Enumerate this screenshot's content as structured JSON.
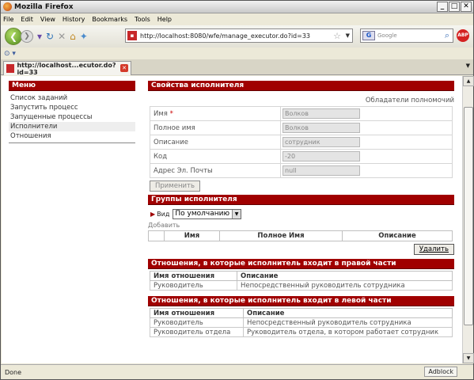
{
  "window": {
    "title": "Mozilla Firefox"
  },
  "menubar": {
    "file": "File",
    "edit": "Edit",
    "view": "View",
    "history": "History",
    "bookmarks": "Bookmarks",
    "tools": "Tools",
    "help": "Help"
  },
  "nav": {
    "url": "http://localhost:8080/wfe/manage_executor.do?id=33",
    "search_placeholder": "Google"
  },
  "tabs": [
    {
      "label": "http://localhost...ecutor.do?id=33"
    }
  ],
  "status": {
    "text": "Done",
    "addon": "Adblock"
  },
  "sidebar": {
    "title": "Меню",
    "items": [
      {
        "label": "Список заданий"
      },
      {
        "label": "Запустить процесс"
      },
      {
        "label": "Запущенные процессы"
      },
      {
        "label": "Исполнители"
      },
      {
        "label": "Отношения"
      }
    ]
  },
  "properties": {
    "title": "Свойства исполнителя",
    "owners_link": "Обладатели полномочий",
    "fields": [
      {
        "label": "Имя",
        "required": "*",
        "value": "Волков"
      },
      {
        "label": "Полное имя",
        "value": "Волков"
      },
      {
        "label": "Описание",
        "value": "сотрудник"
      },
      {
        "label": "Код",
        "value": "-20"
      },
      {
        "label": "Адрес Эл. Почты",
        "value": "null"
      }
    ],
    "apply_label": "Применить"
  },
  "groups": {
    "title": "Группы исполнителя",
    "view_label": "Вид",
    "view_selected": "По умолчанию",
    "add_label": "Добавить",
    "columns": [
      "Имя",
      "Полное Имя",
      "Описание"
    ],
    "delete_label": "Удалить"
  },
  "relations_right": {
    "title": "Отношения, в которые исполнитель входит в правой части",
    "columns": [
      "Имя отношения",
      "Описание"
    ],
    "rows": [
      [
        "Руководитель",
        "Непосредственный руководитель сотрудника"
      ]
    ]
  },
  "relations_left": {
    "title": "Отношения, в которые исполнитель входит в левой части",
    "columns": [
      "Имя отношения",
      "Описание"
    ],
    "rows": [
      [
        "Руководитель",
        "Непосредственный руководитель сотрудника"
      ],
      [
        "Руководитель отдела",
        "Руководитель отдела, в котором работает сотрудник"
      ]
    ]
  }
}
